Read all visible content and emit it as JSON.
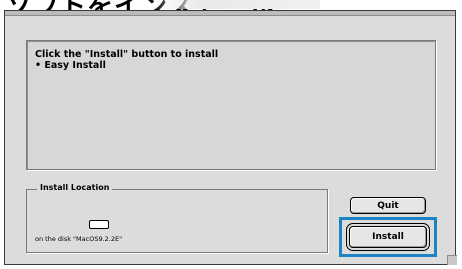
{
  "header": {
    "caption": "ソフトをインストール"
  },
  "message": {
    "line1": "Click the \"Install\" button to install",
    "line2": "• Easy Install"
  },
  "install_location": {
    "legend": "Install Location",
    "disk_caption": "on the disk \"MacOS9.2.2E\""
  },
  "buttons": {
    "quit_label": "Quit",
    "install_label": "Install"
  },
  "colors": {
    "highlight": "#1d83c4",
    "window_bg": "#dcdcdc"
  },
  "icons": {
    "disk": "hard-disk-icon",
    "grow": "resize-grip-icon"
  }
}
